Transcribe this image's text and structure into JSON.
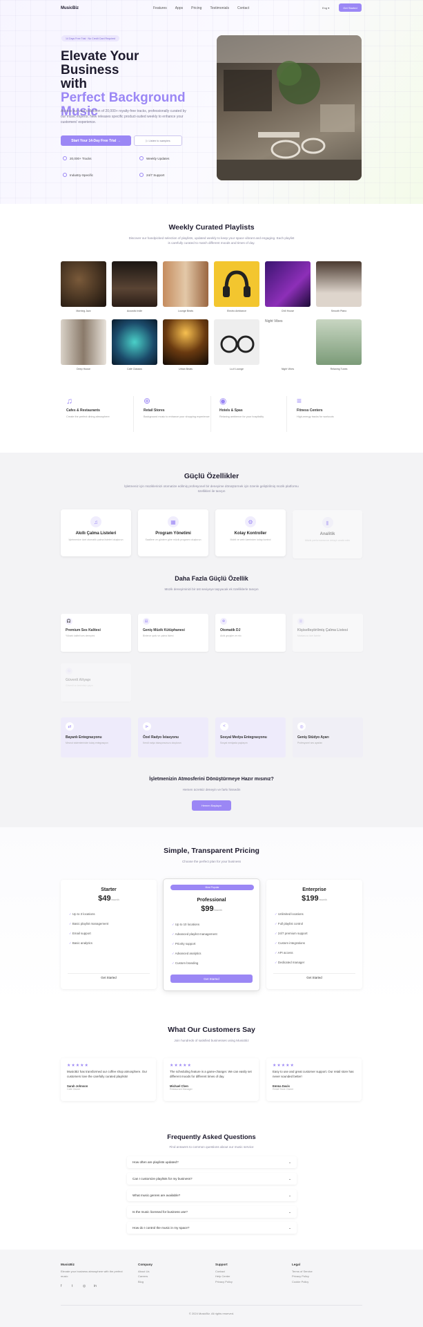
{
  "nav": {
    "logo": "MusicBiz",
    "links": [
      "Features",
      "Apps",
      "Pricing",
      "Testimonials",
      "Contact"
    ],
    "lang": "Eng ▾",
    "cta": "Get Started"
  },
  "hero": {
    "badge": "14 Days Free Trial · No Credit Card Required",
    "title_line1": "Elevate Your Business",
    "title_line2": "with",
    "title_highlight": "Perfect Background Music",
    "paragraph": "Access our vast collection of 20,000+ royalty-free tracks, professionally curated by our music experts. New releases specific product-suited weekly to enhance your customers’ experience.",
    "btn_primary": "Start Your 14-Day Free Trial  →",
    "btn_secondary": "▷  Listen to samples",
    "features": [
      "20,000+ Tracks",
      "Weekly Updates",
      "Industry-Specific",
      "24/7 Support"
    ]
  },
  "playlists": {
    "title": "Weekly Curated Playlists",
    "subtitle": "Discover our handpicked selection of playlists, updated weekly to keep your space vibrant and engaging. Each playlist is carefully curated to match different moods and times of day.",
    "items": [
      "Morning Jazz",
      "Acoustic Indie",
      "Lounge Beats",
      "Electro Ambiance",
      "Chill House",
      "Smooth Piano",
      "Deep House",
      "Café Classics",
      "Urban Beats",
      "Lo-fi Lounge",
      "Night Vibes",
      "Relaxing Tunes"
    ],
    "night_label": "Night Vibes"
  },
  "categories": [
    {
      "icon": "♫",
      "title": "Cafes & Restaurants",
      "desc": "Create the perfect dining atmosphere"
    },
    {
      "icon": "⊕",
      "title": "Retail Stores",
      "desc": "Background music to enhance your shopping experience"
    },
    {
      "icon": "◉",
      "title": "Hotels & Spas",
      "desc": "Relaxing ambience for your hospitality"
    },
    {
      "icon": "≡",
      "title": "Fitness Centers",
      "desc": "High-energy tracks for workouts"
    }
  ],
  "features": {
    "title": "Güçlü Özellikler",
    "subtitle": "İşletmeniz için müziklerinizi otomatize edilmiş profesyonel bir deneyime dönüştürmek için özenle geliştirilmiş müzik platformu özellikleri ile tanışın",
    "cards": [
      {
        "icon": "♫",
        "title": "Akıllı Çalma Listeleri",
        "desc": "İşletmenize özel otomatik çalma listeleri oluşturun"
      },
      {
        "icon": "▦",
        "title": "Program Yönetimi",
        "desc": "Saatlere ve günlere göre müzik programı oluşturun"
      },
      {
        "icon": "⚙",
        "title": "Kolay Kontroller",
        "desc": "Mobil ve web üzerinden kolay kontrol"
      },
      {
        "icon": "▮",
        "title": "Analitik",
        "desc": "Müzik performansınızı detaylı analiz edin"
      }
    ]
  },
  "more": {
    "title": "Daha Fazla Güçlü Özellik",
    "subtitle": "Müzik deneyiminizi bir üst seviyeye taşıyacak ek özelliklerle tanışın",
    "cards": [
      {
        "icon": "🎧",
        "title": "Premium Ses Kalitesi",
        "desc": "Yüksek kaliteli ses deneyimi"
      },
      {
        "icon": "▤",
        "title": "Geniş Müzik Kütüphanesi",
        "desc": "Binlerce şarkı ve çalma listesi"
      },
      {
        "icon": "⊛",
        "title": "Otomatik DJ",
        "desc": "Akıllı geçişler ve mix"
      },
      {
        "icon": "▥",
        "title": "Kişiselleştirilmiş Çalma Listesi",
        "desc": "Markanıza özel listeler"
      },
      {
        "icon": "◇",
        "title": "Güvenli Altyapı",
        "desc": "Güvenli ve kesintisiz yayın"
      }
    ],
    "integrations": [
      {
        "icon": "⇄",
        "title": "Bayanlı Entegrasyonu",
        "desc": "Mevcut sistemlerinizle kolay entegrasyon"
      },
      {
        "icon": "⊳",
        "title": "Özel Radyo İstasyonu",
        "desc": "Kendi radyo istasyonunuzu oluşturun"
      },
      {
        "icon": "<",
        "title": "Sosyal Medya Entegrasyonu",
        "desc": "Sosyal medyada paylaşım"
      },
      {
        "icon": "◎",
        "title": "Geniş Stüdyo Ayarı",
        "desc": "Profesyonel ses ayarları"
      }
    ]
  },
  "cta": {
    "title": "İşletmenizin Atmosferini Dönüştürmeye Hazır mısınız?",
    "subtitle": "Hemen ücretsiz deneyin ve farkı hissedin",
    "button": "Hemen Başlayın"
  },
  "pricing": {
    "title": "Simple, Transparent Pricing",
    "subtitle": "Choose the perfect plan for your business",
    "plans": [
      {
        "name": "Starter",
        "price": "$49",
        "period": "/month",
        "features": [
          "Up to 3 locations",
          "Basic playlist management",
          "Email support",
          "Basic analytics"
        ],
        "button": "Get Started"
      },
      {
        "badge": "Most Popular",
        "name": "Professional",
        "price": "$99",
        "period": "/month",
        "features": [
          "Up to 10 locations",
          "Advanced playlist management",
          "Priority support",
          "Advanced analytics",
          "Custom branding"
        ],
        "button": "Get Started"
      },
      {
        "name": "Enterprise",
        "price": "$199",
        "period": "/month",
        "features": [
          "Unlimited locations",
          "Full playlist control",
          "24/7 premium support",
          "Custom integrations",
          "API access",
          "Dedicated manager"
        ],
        "button": "Get Started"
      }
    ]
  },
  "testimonials": {
    "title": "What Our Customers Say",
    "subtitle": "Join hundreds of satisfied businesses using MusicBiz",
    "items": [
      {
        "stars": "★★★★★",
        "quote": "MusicBiz has transformed our coffee shop atmosphere. Our customers love the carefully curated playlists!",
        "name": "Sarah Johnson",
        "role": "Cafe Owner"
      },
      {
        "stars": "★★★★★",
        "quote": "The scheduling feature is a game-changer. We can easily set different moods for different times of day.",
        "name": "Michael Chen",
        "role": "Restaurant Manager"
      },
      {
        "stars": "★★★★★",
        "quote": "Easy to use and great customer support. Our retail store has never sounded better!",
        "name": "Emma Davis",
        "role": "Retail Store Owner"
      }
    ]
  },
  "faq": {
    "title": "Frequently Asked Questions",
    "subtitle": "Find answers to common questions about our music service",
    "items": [
      "How often are playlists updated?",
      "Can I customize playlists for my business?",
      "What music genres are available?",
      "Is the music licensed for business use?",
      "How do I control the music in my space?"
    ]
  },
  "footer": {
    "brand": "MusicBiz",
    "tagline": "Elevate your business atmosphere with the perfect music",
    "cols": [
      {
        "head": "Company",
        "links": [
          "About Us",
          "Careers",
          "Blog"
        ]
      },
      {
        "head": "Support",
        "links": [
          "Contact",
          "Help Center",
          "Privacy Policy"
        ]
      },
      {
        "head": "Legal",
        "links": [
          "Terms of Service",
          "Privacy Policy",
          "Cookie Policy"
        ]
      }
    ],
    "social": [
      "f",
      "t",
      "◎",
      "in"
    ],
    "copyright": "© 2024 MusicBiz. All rights reserved."
  }
}
